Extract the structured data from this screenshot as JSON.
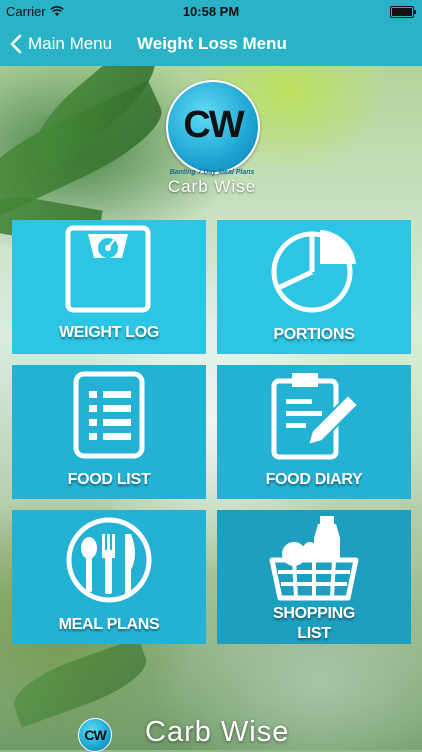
{
  "status_bar": {
    "carrier": "Carrier",
    "time": "10:58 PM"
  },
  "nav": {
    "back_label": "Main Menu",
    "title": "Weight Loss Menu"
  },
  "logo": {
    "initials": "CW",
    "tagline": "Banting 7 Day Meal Plans",
    "name": "Carb Wise"
  },
  "tiles": [
    {
      "label": "WEIGHT LOG",
      "icon": "scale-icon"
    },
    {
      "label": "PORTIONS",
      "icon": "pie-chart-icon"
    },
    {
      "label": "FOOD LIST",
      "icon": "list-icon"
    },
    {
      "label": "FOOD DIARY",
      "icon": "clipboard-pencil-icon"
    },
    {
      "label": "MEAL PLANS",
      "icon": "cutlery-plate-icon"
    },
    {
      "label_line1": "SHOPPING",
      "label_line2": "LIST",
      "icon": "shopping-basket-icon"
    }
  ],
  "footer": {
    "initials": "CW",
    "name": "Carb Wise"
  },
  "colors": {
    "bar": "#2ab3c6",
    "tile_light": "#2cc5e3",
    "tile_mid": "#24b2d4",
    "tile_dark": "#1e9fc0"
  }
}
